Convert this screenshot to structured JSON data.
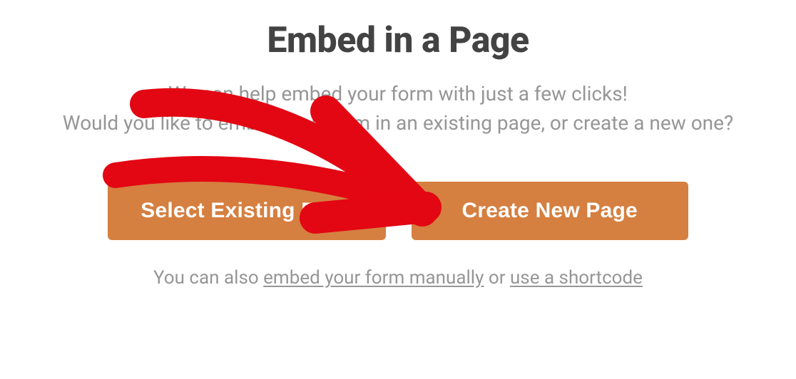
{
  "dialog": {
    "heading": "Embed in a Page",
    "subtext_line1": "We can help embed your form with just a few clicks!",
    "subtext_line2": "Would you like to embed your form in an existing page, or create a new one?",
    "buttons": {
      "select_existing": "Select Existing Page",
      "create_new": "Create New Page"
    },
    "footer": {
      "prefix": "You can also ",
      "link_manual": "embed your form manually",
      "middle": " or ",
      "link_shortcode": "use a shortcode"
    }
  },
  "annotation": {
    "arrow_color": "#e30613",
    "arrow_target": "create-new-page-button"
  }
}
